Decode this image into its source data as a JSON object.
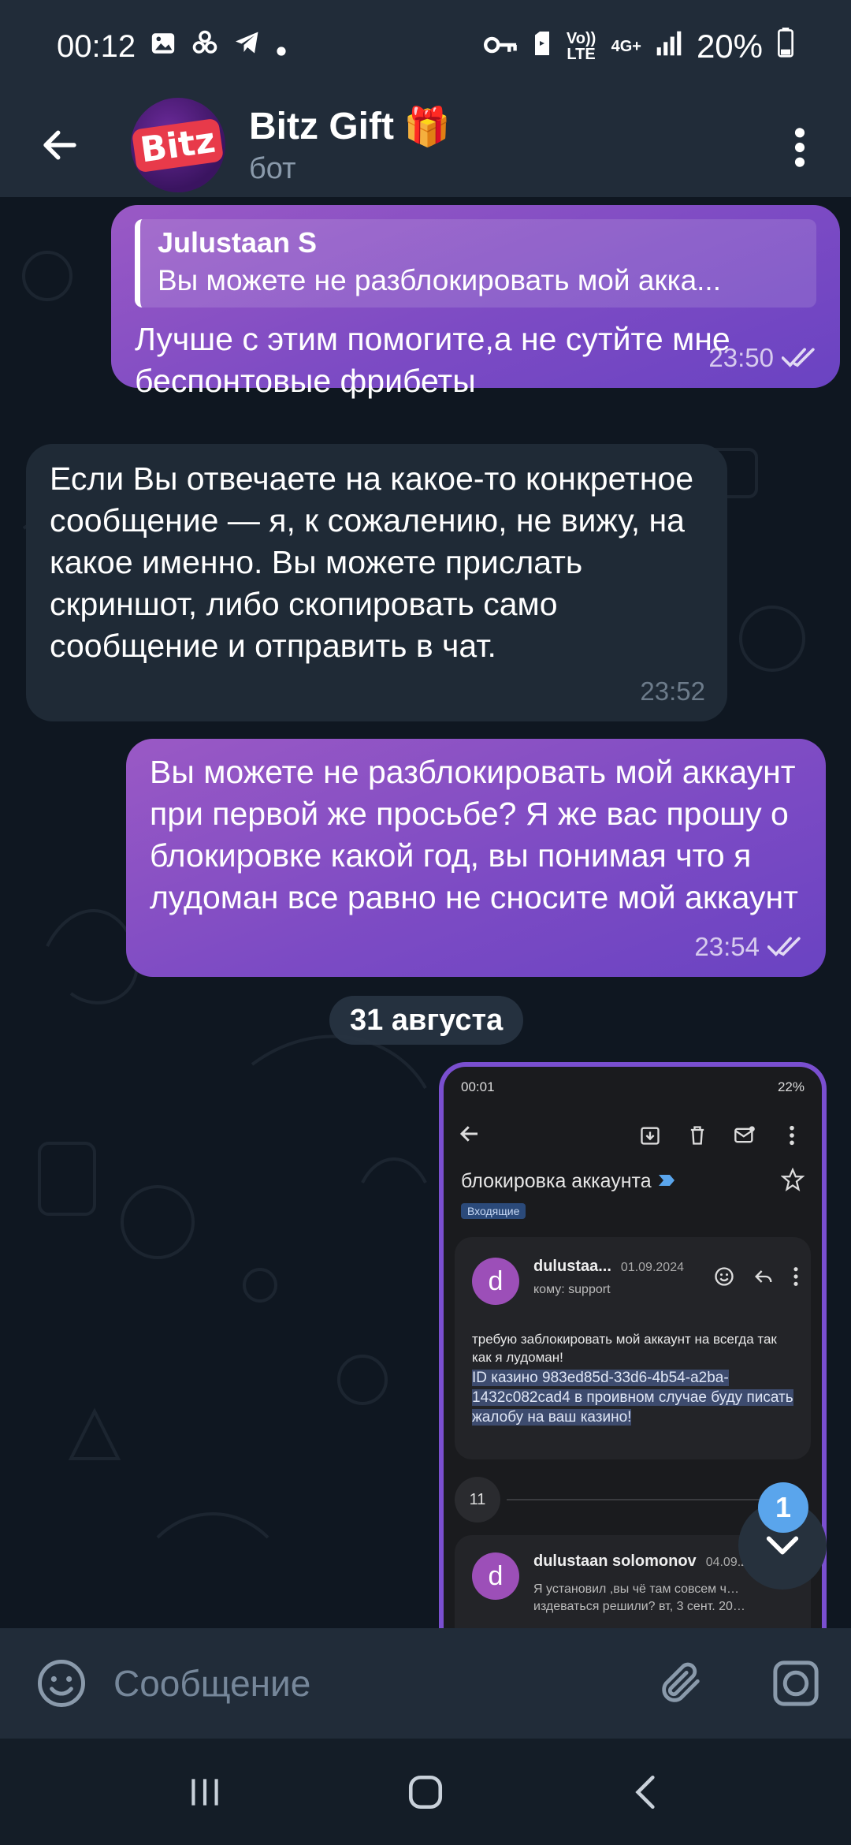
{
  "status_bar": {
    "time": "00:12",
    "volte": "Vo)) LTE",
    "network": "4G+",
    "battery": "20%"
  },
  "header": {
    "title": "Bitz Gift",
    "title_emoji": "🎁",
    "subtitle": "бот",
    "avatar_logo": "Bitz"
  },
  "messages": [
    {
      "direction": "out",
      "reply_name": "Julustaan S",
      "reply_text": "Вы можете не разблокировать мой акка...",
      "text": "Лучше с этим помогите,а не сутйте мне беспонтовые фрибеты",
      "time": "23:50"
    },
    {
      "direction": "in",
      "text": "Если Вы отвечаете на какое-то конкретное сообщение — я, к сожалению, не вижу, на какое именно. Вы можете прислать скриншот, либо скопировать само сообщение и отправить в чат.",
      "time": "23:52"
    },
    {
      "direction": "out",
      "text": "Вы можете не разблокировать мой аккаунт при первой же просьбе? Я же вас прошу о блокировке какой год, вы понимая что я лудоман все равно не сносите мой аккаунт",
      "time": "23:54"
    }
  ],
  "date_separator": "31 августа",
  "screenshot": {
    "status_time": "00:01",
    "status_battery": "22%",
    "subject": "блокировка аккаунта",
    "label": "Входящие",
    "email1": {
      "avatar": "d",
      "sender": "dulustaa...",
      "date": "01.09.2024",
      "to": "кому: support",
      "body_plain": "требую заблокировать мой аккаунт на всегда так как я лудоман!",
      "body_highlight": "ID казино 983ed85d-33d6-4b54-a2ba-1432c082cad4 в проивном случае буду писать жалобу на ваш казино!"
    },
    "hidden_count": "11",
    "email2": {
      "avatar": "d",
      "sender": "dulustaan solomonov",
      "date": "04.09.20",
      "snippet": "Я установил ,вы чё там совсем ч… издеваться решили? вт, 3 сент. 20…"
    }
  },
  "unread_count": "1",
  "input": {
    "placeholder": "Сообщение"
  },
  "colors": {
    "out_bubble": "#8a52c4",
    "in_bubble": "#1f2a36",
    "header_bg": "#212c39",
    "chat_bg": "#0f1721",
    "accent_badge": "#5aa5ec"
  }
}
